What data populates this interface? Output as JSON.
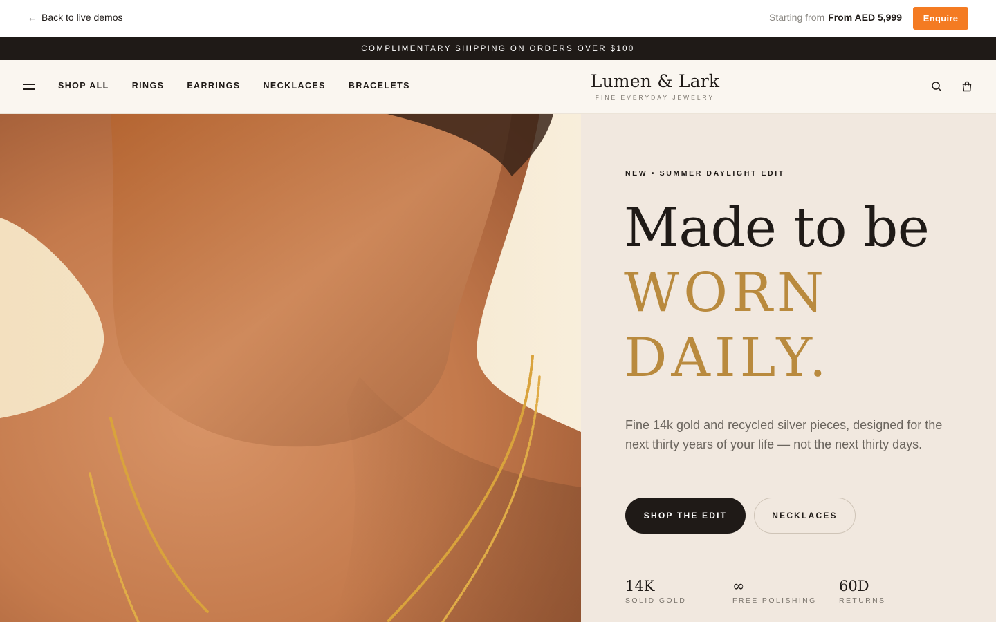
{
  "demo_bar": {
    "back_label": "Back to live demos",
    "price_prefix": "Starting from",
    "price_value": "From AED 5,999",
    "enquire_label": "Enquire",
    "accent_color": "#f47b22"
  },
  "announcement": {
    "text": "COMPLIMENTARY SHIPPING ON ORDERS OVER $100"
  },
  "nav": {
    "links": [
      "SHOP ALL",
      "RINGS",
      "EARRINGS",
      "NECKLACES",
      "BRACELETS"
    ],
    "brand_name": "Lumen & Lark",
    "brand_tagline": "FINE EVERYDAY JEWELRY",
    "icons": [
      "menu-icon",
      "search-icon",
      "bag-icon"
    ]
  },
  "hero": {
    "eyebrow": "NEW • SUMMER DAYLIGHT EDIT",
    "headline_line1": "Made to be",
    "headline_line2": "WORN",
    "headline_line3": "DAILY.",
    "description": "Fine 14k gold and recycled silver pieces, designed for the next thirty years of your life — not the next thirty days.",
    "primary_cta": "SHOP THE EDIT",
    "secondary_cta": "NECKLACES",
    "accent_color": "#b98a3e",
    "stats": [
      {
        "value": "14K",
        "label": "SOLID GOLD"
      },
      {
        "value": "∞",
        "label": "FREE POLISHING"
      },
      {
        "value": "60D",
        "label": "RETURNS"
      }
    ]
  }
}
